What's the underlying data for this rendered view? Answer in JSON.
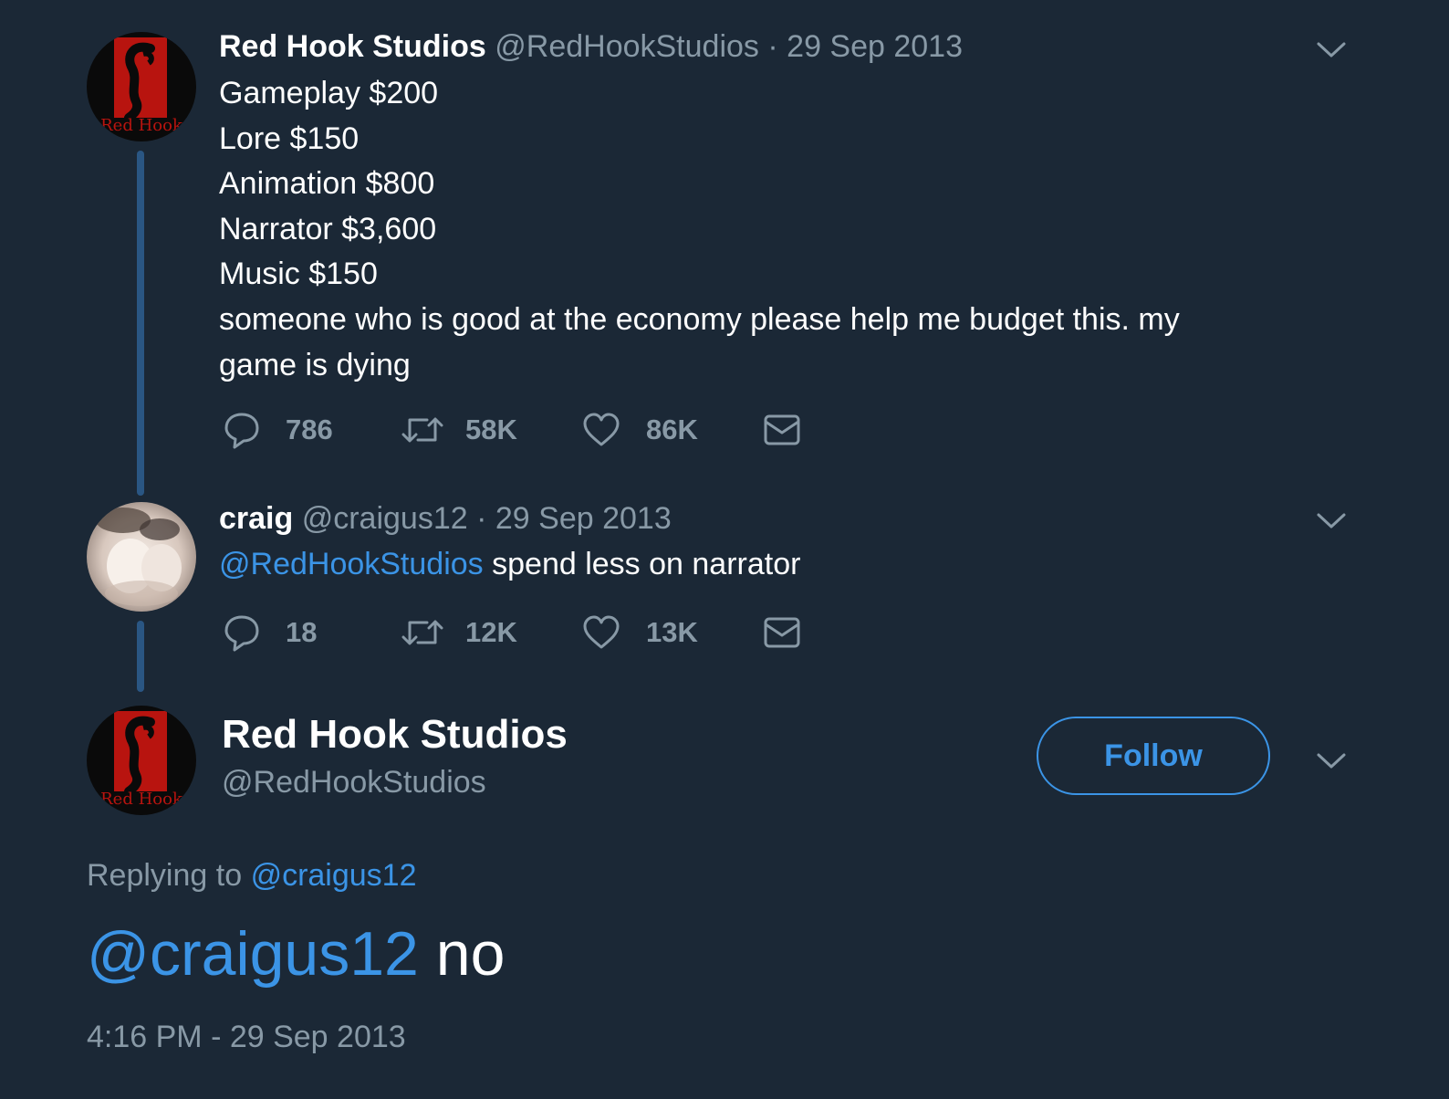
{
  "tweets": [
    {
      "name": "Red Hook Studios",
      "handle": "@RedHookStudios",
      "separator": "·",
      "date": "29 Sep 2013",
      "lines": [
        "Gameplay $200",
        "Lore $150",
        "Animation $800",
        "Narrator $3,600",
        "Music $150",
        "someone who is good at the economy please help me budget this. my",
        "game is dying"
      ],
      "replies": "786",
      "retweets": "58K",
      "likes": "86K"
    },
    {
      "name": "craig",
      "handle": "@craigus12",
      "separator": "·",
      "date": "29 Sep 2013",
      "mention": "@RedHookStudios",
      "text": "spend less on narrator",
      "replies": "18",
      "retweets": "12K",
      "likes": "13K"
    }
  ],
  "focus_tweet": {
    "name": "Red Hook Studios",
    "handle": "@RedHookStudios",
    "follow_label": "Follow",
    "replying_prefix": "Replying to",
    "replying_handle": "@craigus12",
    "mention": "@craigus12",
    "text": "no",
    "timestamp": "4:16 PM - 29 Sep 2013"
  },
  "avatar_text": "Red Hook",
  "icons": {
    "reply": "speech-bubble-icon",
    "retweet": "retweet-icon",
    "like": "heart-icon",
    "dm": "envelope-icon",
    "caret": "chevron-down-icon"
  },
  "colors": {
    "background": "#1b2836",
    "text": "#ffffff",
    "muted": "#8899a6",
    "accent": "#3b94e6",
    "thread_line": "#2a5683"
  }
}
